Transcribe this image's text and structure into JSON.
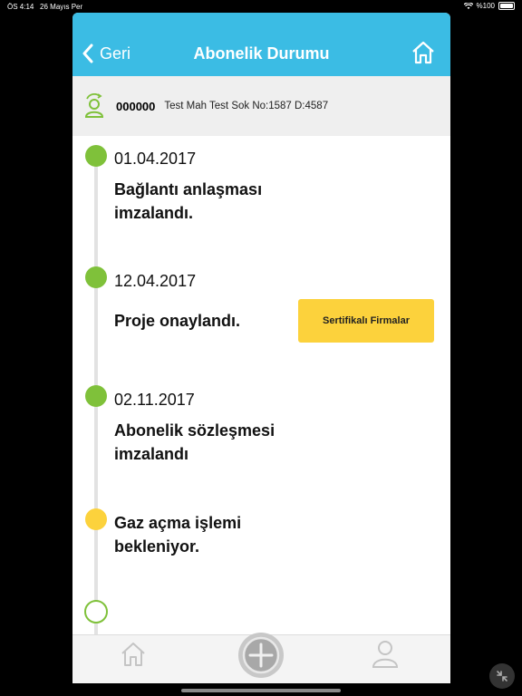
{
  "status": {
    "time": "ÖS 4:14",
    "date": "26 Mayıs Per",
    "battery": "%100"
  },
  "header": {
    "back_label": "Geri",
    "title": "Abonelik Durumu"
  },
  "subscriber": {
    "number": "000000",
    "address": "Test Mah Test Sok No:1587 D:4587"
  },
  "timeline": [
    {
      "date": "01.04.2017",
      "text_line1": "Bağlantı anlaşması",
      "text_line2": "imzalandı.",
      "status": "done"
    },
    {
      "date": "12.04.2017",
      "text_line1": "Proje onaylandı.",
      "status": "done",
      "button_label": "Sertifikalı Firmalar"
    },
    {
      "date": "02.11.2017",
      "text_line1": "Abonelik sözleşmesi",
      "text_line2": "imzalandı",
      "status": "done"
    },
    {
      "text_line1": "Gaz açma işlemi",
      "text_line2": "bekleniyor.",
      "status": "pending"
    },
    {
      "status": "empty"
    }
  ],
  "colors": {
    "header": "#3bbce4",
    "done": "#7fc13a",
    "pending": "#fcd23c",
    "button": "#fcd23c"
  },
  "icons": [
    "back-chevron-icon",
    "home-icon",
    "user-icon",
    "add-icon",
    "wifi-icon",
    "battery-icon",
    "collapse-icon"
  ]
}
